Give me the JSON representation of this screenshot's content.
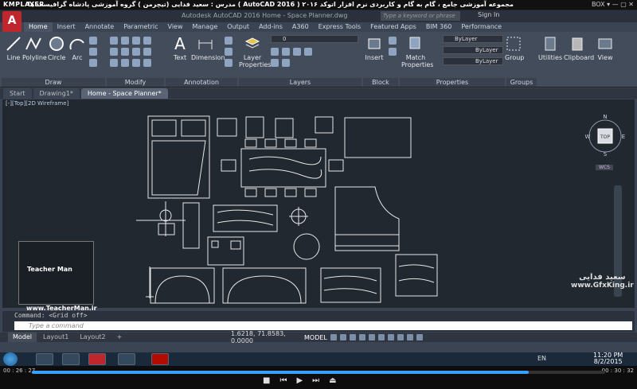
{
  "player": {
    "logo": "KMPLAYER",
    "title": "مجموعه آموزشی جامع ، گام به گام و کاربردی نرم افزار اتوکد ۲۰۱۶ ( AutoCAD 2016 ) مدرس : سعید فدایی (تیچرمن ) گروه آموزشی پادشاه گرافیست ها",
    "controls": "BOX ▾  —  ▢  ✕",
    "time_elapsed": "00 : 26 : 27",
    "time_total": "00 : 30 : 32",
    "progress": 0.866
  },
  "acad": {
    "logo": "A",
    "title": "Autodesk AutoCAD 2016    Home - Space Planner.dwg",
    "search_placeholder": "Type a keyword or phrase",
    "signin": "Sign In",
    "ribbon_tabs": [
      "Home",
      "Insert",
      "Annotate",
      "Parametric",
      "View",
      "Manage",
      "Output",
      "Add-ins",
      "A360",
      "Express Tools",
      "Featured Apps",
      "BIM 360",
      "Performance"
    ],
    "draw_tools": [
      "Line",
      "Polyline",
      "Circle",
      "Arc"
    ],
    "modify_tools": [
      "Text",
      "Dimension"
    ],
    "layer_tools": [
      "Layer Properties"
    ],
    "layer_combo": "0",
    "block_tools": [
      "Insert"
    ],
    "prop_tools": [
      "Match Properties"
    ],
    "prop_combos": [
      "ByLayer",
      "ByLayer",
      "ByLayer"
    ],
    "right_tools": [
      "Group",
      "Utilities",
      "Clipboard",
      "View"
    ],
    "panels": [
      "Draw",
      "Modify",
      "Annotation",
      "Layers",
      "Block",
      "Properties",
      "Groups"
    ],
    "doc_tabs": [
      "Start",
      "Drawing1*",
      "Home - Space Planner*"
    ],
    "viewport_label": "[-][Top][2D Wireframe]",
    "viewcube": {
      "n": "N",
      "s": "S",
      "e": "E",
      "w": "W",
      "top": "TOP",
      "wcs": "WCS"
    },
    "command_history": "Command: <Grid off>",
    "command_placeholder": "Type a command",
    "layout_tabs": [
      "Model",
      "Layout1",
      "Layout2",
      "+"
    ],
    "coords": "1.6218, 71.8583, 0.0000",
    "status_model": "MODEL"
  },
  "watermarks": {
    "left_url": "www.TeacherMan.ir",
    "left_name": "Teacher Man",
    "right_name": "سعید فدایی",
    "right_url": "www.GfxKing.ir"
  },
  "taskbar": {
    "lang": "EN",
    "time": "11:20 PM",
    "date": "8/2/2015"
  },
  "colors": {
    "acad_red": "#c0262d",
    "canvas": "#212830",
    "ribbon": "#434c5b",
    "seek": "#3aa0ff"
  }
}
